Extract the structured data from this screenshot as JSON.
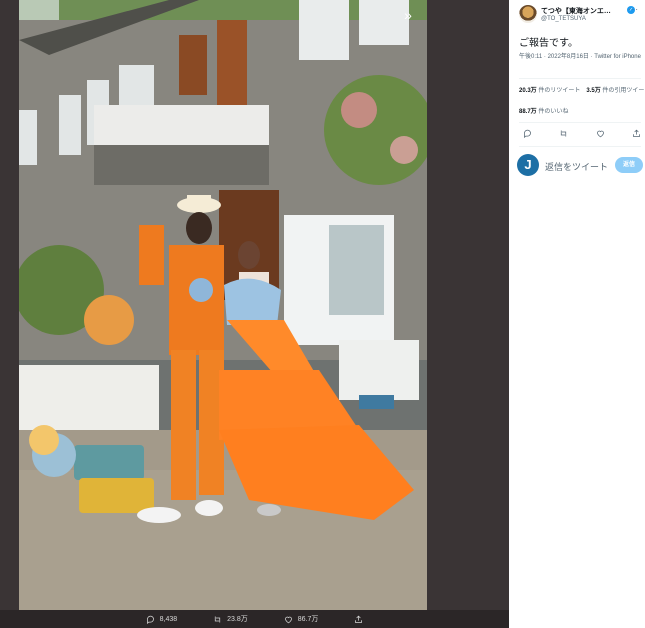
{
  "tweet": {
    "author_name": "てつや【東海オンエ…",
    "author_handle": "@TO_TETSUYA",
    "text": "ご報告です。",
    "timestamp": "午後0:11 · 2022年8月16日 · Twitter for iPhone",
    "retweets_count": "20.3万",
    "retweets_label": "件のリツイート",
    "quotes_count": "3.5万",
    "quotes_label": "件の引用ツイー",
    "likes_count": "88.7万",
    "likes_label": "件のいいね"
  },
  "reply": {
    "avatar_letter": "J",
    "placeholder": "返信をツイート",
    "button_label": "返信"
  },
  "viewer_actions": {
    "replies": "8,438",
    "retweets": "23.8万",
    "likes": "86.7万"
  },
  "icons": [
    "expand-icon",
    "reply-icon",
    "retweet-icon",
    "like-icon",
    "share-icon",
    "more-icon",
    "verified-badge-icon"
  ],
  "colors": {
    "accent": "#1d9bf0",
    "reply_button": "#8ecdf8",
    "viewer_bg": "#3a3435"
  }
}
